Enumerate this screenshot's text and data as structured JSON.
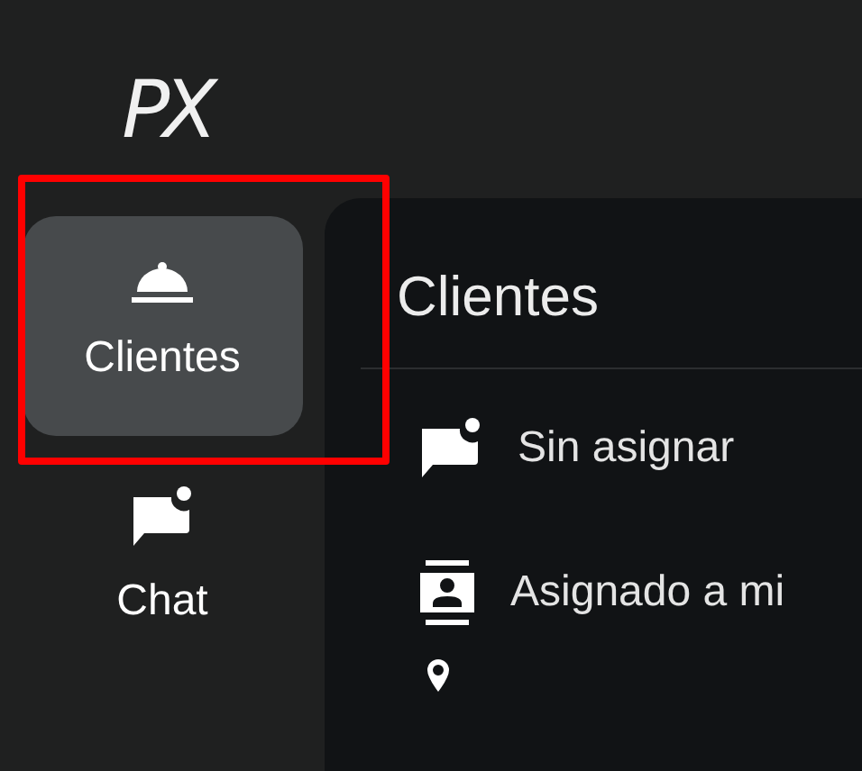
{
  "logo": "PX",
  "nav": [
    {
      "label": "Clientes",
      "kind": "bell",
      "selected": true,
      "highlighted": true
    },
    {
      "label": "Chat",
      "kind": "chat",
      "selected": false,
      "highlighted": false
    }
  ],
  "panel": {
    "title": "Clientes",
    "items": [
      {
        "label": "Sin asignar",
        "kind": "chat"
      },
      {
        "label": "Asignado a mi",
        "kind": "contact"
      }
    ]
  }
}
